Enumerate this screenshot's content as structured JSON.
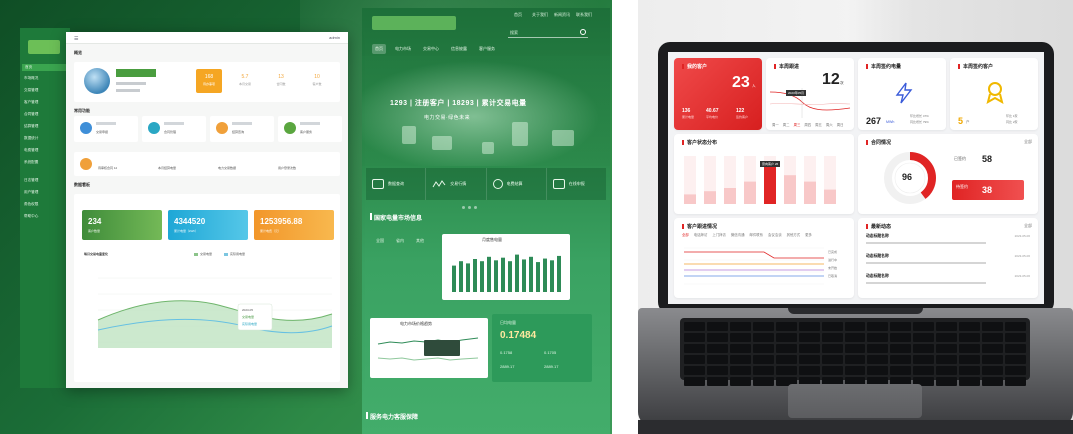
{
  "left_site": {
    "top_links": [
      "首页",
      "关于我们",
      "新闻资讯",
      "联系我们"
    ],
    "nav": [
      "首页",
      "电力市场",
      "交易中心",
      "信息披露",
      "客户服务"
    ],
    "search_placeholder": "搜索",
    "hero_line": "1293 | 注册客户 | 18293 | 累计交易电量",
    "hero_sub": "电力交易·绿色未来",
    "icons": [
      {
        "name": "chart-icon",
        "label": "数据查询"
      },
      {
        "name": "wave-icon",
        "label": "交易行情"
      },
      {
        "name": "coin-icon",
        "label": "电费结算"
      },
      {
        "name": "edit-icon",
        "label": "在线申报"
      }
    ],
    "section_title": "国家电量市场信息",
    "tabs": [
      "全国",
      "省内",
      "其他"
    ],
    "bar_chart_title": "月度售电量",
    "line_chart_title": "电力市场价格趋势",
    "stat_title": "日均电量",
    "stat_big": "0.17484",
    "stat_items": [
      "0.1758",
      "0.1705",
      "2889.17",
      "2889.17"
    ],
    "bottom_title": "服务电力客服保障"
  },
  "green_sidebar": {
    "items": [
      "首页",
      "市场概况",
      "交易管理",
      "客户管理",
      "合同管理",
      "结算管理",
      "数据统计",
      "电费管理",
      "系统配置",
      "日志管理",
      "用户管理",
      "角色权限",
      "帮助中心"
    ]
  },
  "dashboard": {
    "user": "admin",
    "sec_profile": "概览",
    "sec_apps": "常用功能",
    "sec_data": "数据看板",
    "profile_stats": [
      {
        "value": "168",
        "label": "待办事项",
        "color": "#f2a63a",
        "bg": "#f5a623"
      },
      {
        "value": "5.7",
        "label": "本月交易",
        "color": "#f2a63a",
        "bg": "#fff6e8"
      },
      {
        "value": "13",
        "label": "合同数",
        "color": "#f2a63a",
        "bg": "#fff6e8"
      },
      {
        "value": "10",
        "label": "客户数",
        "color": "#f2a63a",
        "bg": "#fff6e8"
      }
    ],
    "apps": [
      {
        "color": "#3f8fd8",
        "sub": "交易申报"
      },
      {
        "color": "#2aa7c4",
        "sub": "合同管理"
      },
      {
        "color": "#f0a03a",
        "sub": "结算查询"
      },
      {
        "color": "#5aa63f",
        "sub": "客户服务"
      }
    ],
    "wide_card_items": [
      "待审核合同 12",
      "本月结算电量",
      "电力交易数据",
      "用户登录次数"
    ],
    "data_cards": [
      {
        "value": "234",
        "label": "客户数量",
        "bg": "#4a9a44"
      },
      {
        "value": "4344520",
        "label": "累计电量（kWh）",
        "bg": "#2ab0d8"
      },
      {
        "value": "1253956.88",
        "label": "累计电费（元）",
        "bg": "#f2a030"
      }
    ],
    "chart_title": "每月交易电量变化",
    "legend": [
      "交易电量",
      "实际用电量"
    ],
    "tooltip": [
      "2023-05",
      "交易电量",
      "实际用电量"
    ]
  },
  "laptop": {
    "card_clients": {
      "title": "我的客户",
      "value": "23",
      "unit": "人",
      "stats": [
        {
          "v": "136",
          "l": "累计电量"
        },
        {
          "v": "40.67",
          "l": "平均电价"
        },
        {
          "v": "122",
          "l": "签约客户"
        }
      ]
    },
    "card_follow": {
      "title": "本周跟进",
      "value": "12",
      "unit": "次",
      "badge": "2023年05月",
      "days": [
        "周一",
        "周二",
        "周三",
        "周四",
        "周五",
        "周六",
        "周日"
      ]
    },
    "card_power": {
      "title": "本周签约电量",
      "value": "267",
      "unit": "MWh",
      "rows": [
        "环比增长 47%",
        "同比增长 79%"
      ]
    },
    "card_signed": {
      "title": "本周签约客户",
      "value": "5",
      "unit": "户",
      "rows": [
        "环比 1家",
        "同比 2家"
      ]
    },
    "card_distribution": {
      "title": "客户状态分布",
      "tooltip": "意向客户 26",
      "peak": "26"
    },
    "card_contract": {
      "title": "合同情况",
      "more": "全部",
      "donut_value": "96",
      "signed_label": "已签约",
      "signed_value": "58",
      "pending_label": "待签约",
      "pending_value": "38"
    },
    "card_progress": {
      "title": "客户跟进情况",
      "tabs": [
        "全部",
        "电话拜访",
        "上门拜访",
        "微信沟通",
        "邮件联系",
        "会议洽谈",
        "其他方式",
        "更多"
      ],
      "legend": [
        "已完成",
        "进行中",
        "未开始",
        "已取消"
      ]
    },
    "card_feed": {
      "title": "最新动态",
      "more": "全部",
      "items": [
        {
          "title": "动态标题名称",
          "time": "2023-05-06"
        },
        {
          "title": "动态标题名称",
          "time": "2023-05-06"
        },
        {
          "title": "动态标题名称",
          "time": "2023-05-06"
        }
      ]
    }
  },
  "chart_data": {
    "type": "bar",
    "title": "",
    "categories": [
      "A",
      "B",
      "C",
      "D",
      "E",
      "F",
      "G",
      "H"
    ],
    "values": [
      6,
      8,
      10,
      14,
      26,
      18,
      14,
      9
    ],
    "ylim": [
      0,
      30
    ]
  }
}
